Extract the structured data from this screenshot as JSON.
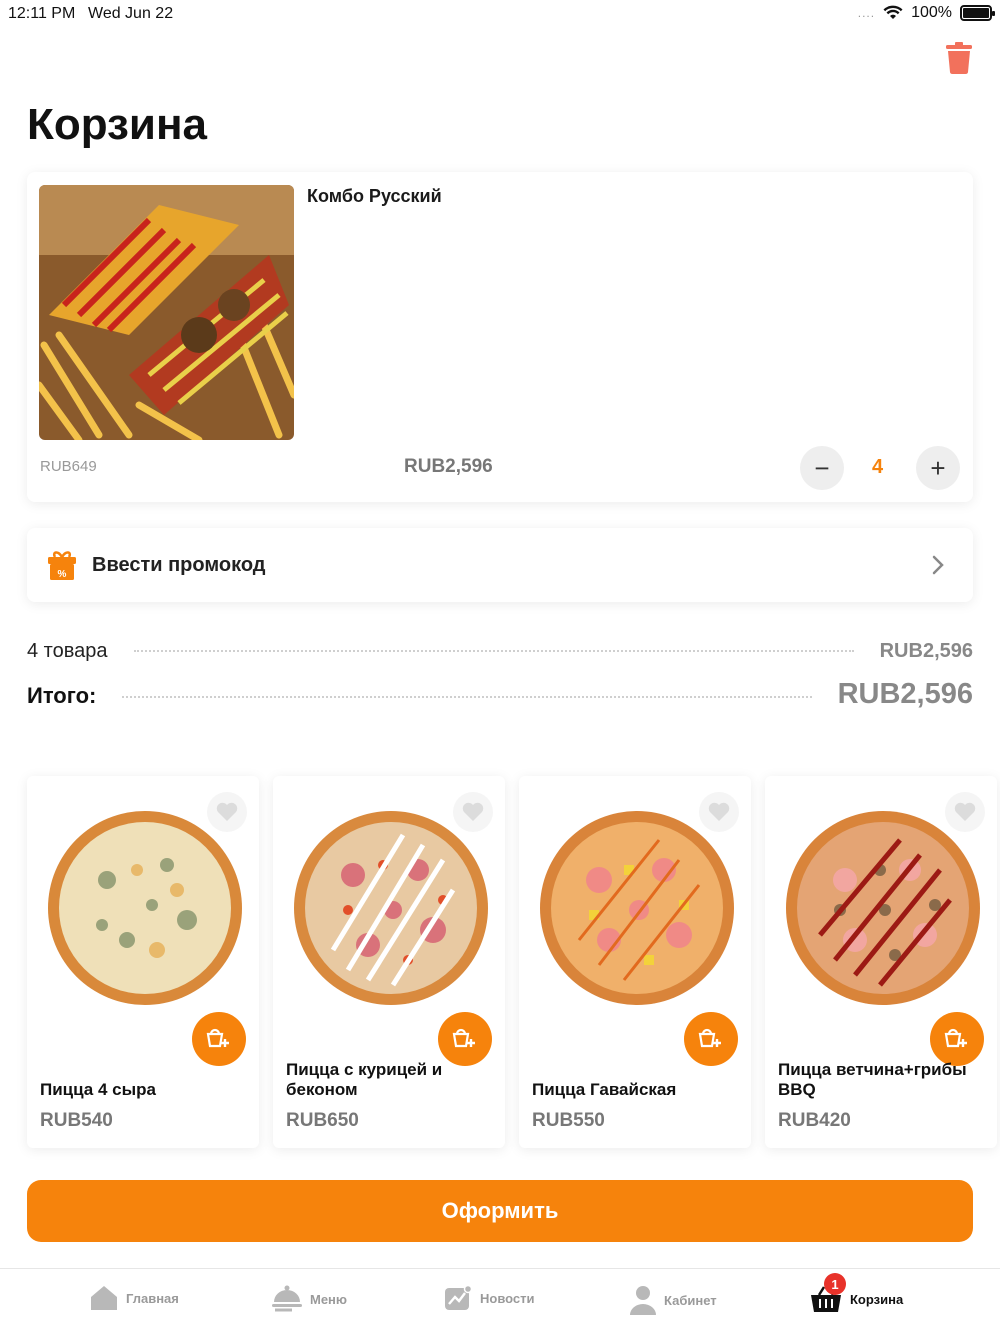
{
  "status_bar": {
    "time": "12:11 PM",
    "date": "Wed Jun 22",
    "signal_dots": "....",
    "battery": "100%"
  },
  "page": {
    "title": "Корзина"
  },
  "cart_item": {
    "name": "Комбо Русский",
    "unit_price": "RUB649",
    "total_price": "RUB2,596",
    "quantity": "4",
    "minus_label": "−",
    "plus_label": "+"
  },
  "promo": {
    "label": "Ввести промокод",
    "icon": "gift-percent-icon"
  },
  "summary": {
    "items_label": "4 товара",
    "items_value": "RUB2,596",
    "total_label": "Итого:",
    "total_value": "RUB2,596"
  },
  "recommendations": [
    {
      "name": "Пицца 4 сыра",
      "price": "RUB540"
    },
    {
      "name": "Пицца с курицей и беконом",
      "price": "RUB650"
    },
    {
      "name": "Пицца Гавайская",
      "price": "RUB550"
    },
    {
      "name": "Пицца ветчина+грибы BBQ",
      "price": "RUB420"
    }
  ],
  "checkout": {
    "label": "Оформить"
  },
  "tabbar": {
    "items": [
      {
        "label": "Главная",
        "icon": "home-icon"
      },
      {
        "label": "Меню",
        "icon": "menu-cloche-icon"
      },
      {
        "label": "Новости",
        "icon": "news-chart-icon"
      },
      {
        "label": "Кабинет",
        "icon": "user-icon"
      },
      {
        "label": "Корзина",
        "icon": "basket-icon",
        "badge": "1"
      }
    ]
  },
  "colors": {
    "accent": "#f6830c",
    "badge": "#e8322a",
    "trash": "#f2715c"
  }
}
